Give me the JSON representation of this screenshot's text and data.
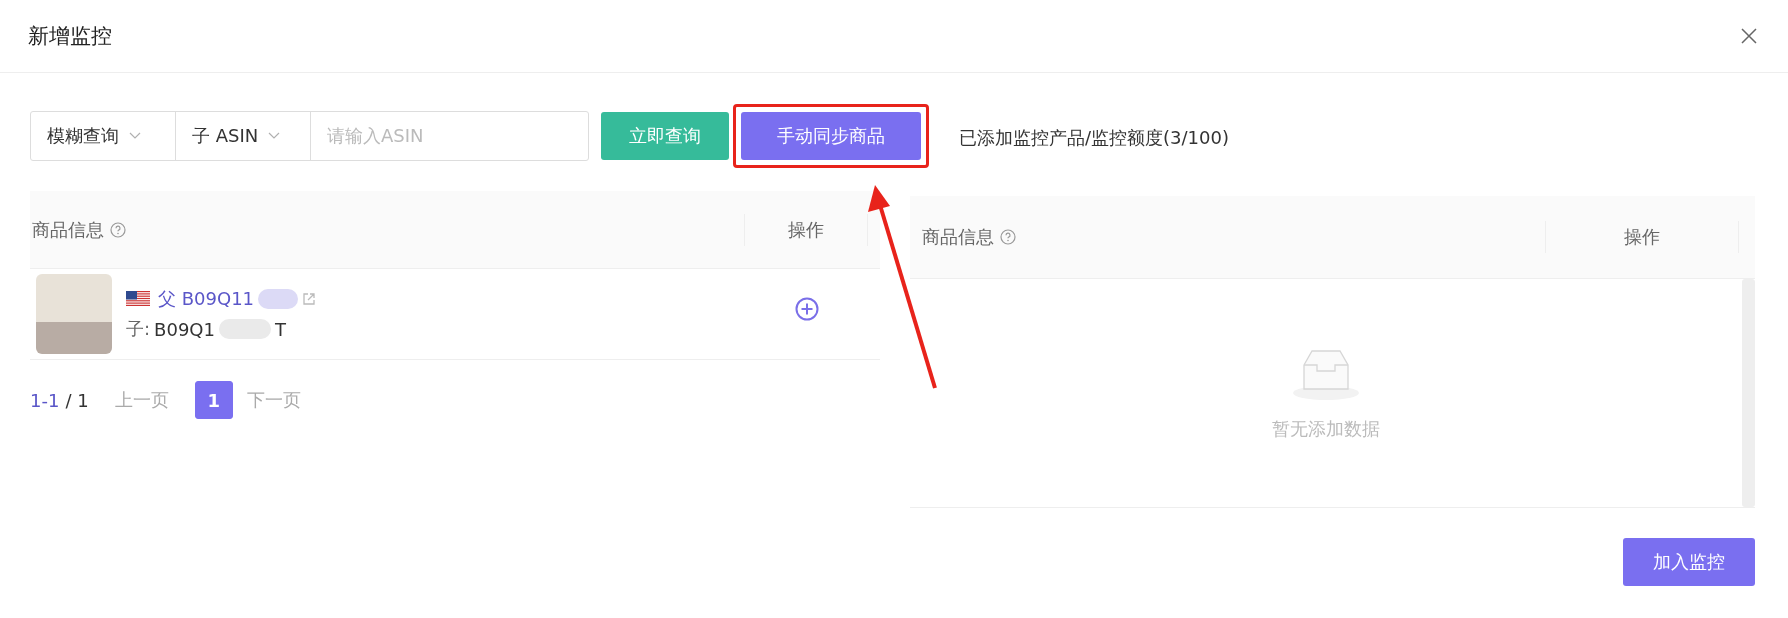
{
  "window": {
    "title": "新增监控"
  },
  "toolbar": {
    "search_mode": "模糊查询",
    "asin_type": "子 ASIN",
    "search": {
      "placeholder": "请输入ASIN"
    },
    "query_button": "立即查询",
    "sync_button": "手动同步商品",
    "quota": "已添加监控产品/监控额度(3/100)"
  },
  "left_table": {
    "columns": [
      "商品信息",
      "操作"
    ],
    "rows": [
      {
        "parent_label": "父",
        "parent_asin": "B09Q11",
        "child_label": "子:",
        "child_asin": "B09Q1",
        "child_asin_end": "T"
      }
    ],
    "pagination": {
      "range": "1-1",
      "total": "/ 1",
      "prev": "上一页",
      "pages": [
        {
          "label": "1",
          "selected": true
        }
      ],
      "next": "下一页"
    }
  },
  "right_table": {
    "columns": [
      "商品信息",
      "操作"
    ],
    "empty_text": "暂无添加数据"
  },
  "footer": {
    "add_button": "加入监控"
  }
}
